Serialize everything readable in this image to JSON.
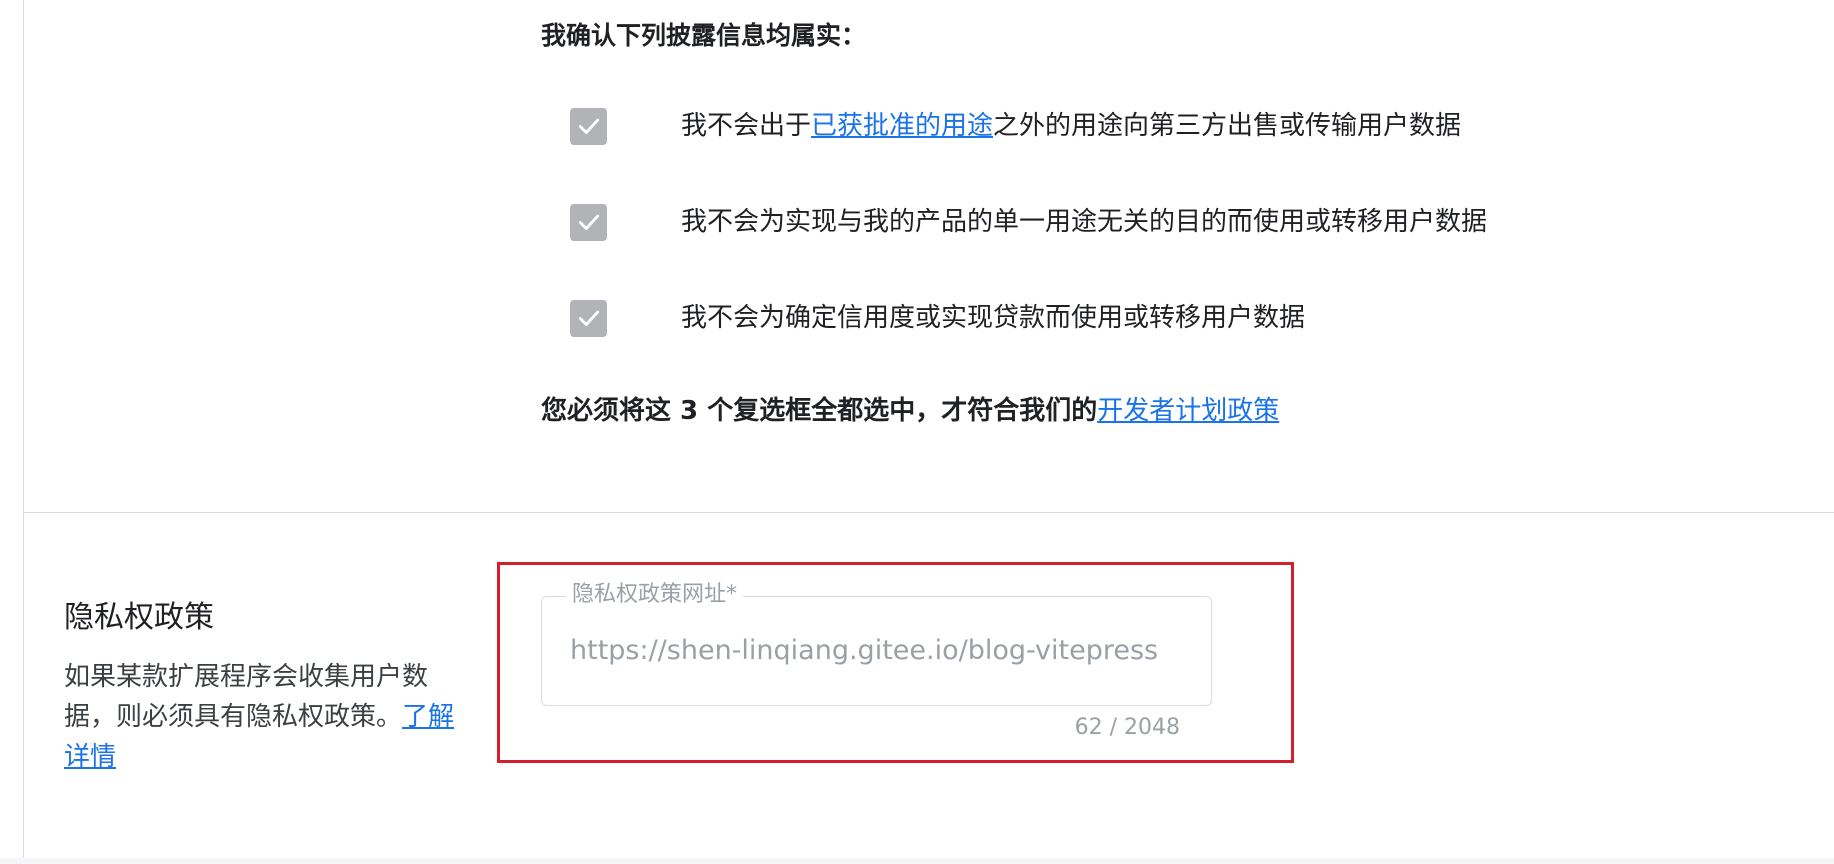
{
  "certification": {
    "heading": "我确认下列披露信息均属实：",
    "items": [
      {
        "checked": true,
        "text_before": "我不会出于",
        "link_text": "已获批准的用途",
        "text_after": "之外的用途向第三方出售或传输用户数据"
      },
      {
        "checked": true,
        "text": "我不会为实现与我的产品的单一用途无关的目的而使用或转移用户数据"
      },
      {
        "checked": true,
        "text": "我不会为确定信用度或实现贷款而使用或转移用户数据"
      }
    ],
    "requirement_text": "您必须将这 3 个复选框全都选中，才符合我们的",
    "requirement_link": "开发者计划政策"
  },
  "privacy_policy": {
    "title": "隐私权政策",
    "description": "如果某款扩展程序会收集用户数据，则必须具有隐私权政策。",
    "learn_more_link": "了解详情",
    "field_label": "隐私权政策网址*",
    "field_value": "https://shen-linqiang.gitee.io/blog-vitepress",
    "char_count": "62 / 2048"
  },
  "colors": {
    "link": "#1a73e8",
    "checkbox_disabled": "#b1b3b7",
    "highlight_border": "#d11f2b"
  }
}
